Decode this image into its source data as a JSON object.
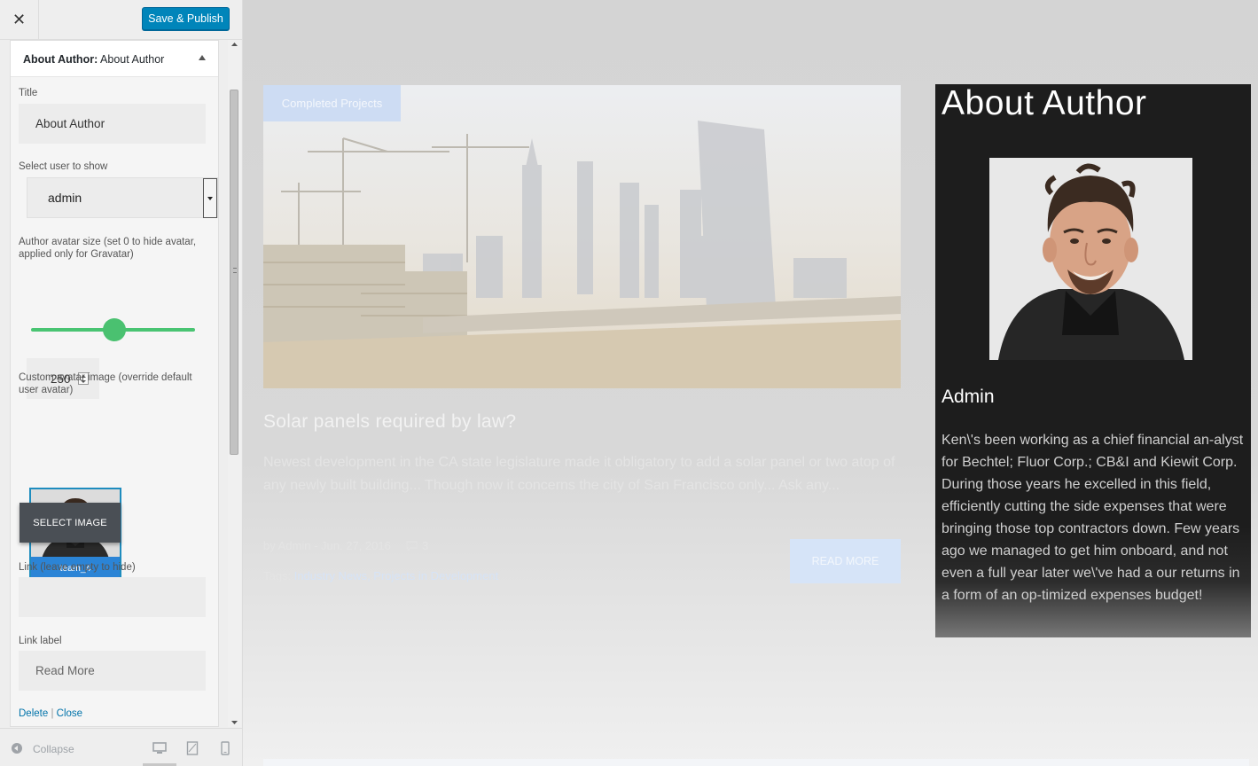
{
  "topbar": {
    "close_glyph": "✕",
    "publish_label": "Save & Publish"
  },
  "panel": {
    "title_prefix": "About Author:",
    "title_suffix": "About Author"
  },
  "form": {
    "title_label": "Title",
    "title_value": "About Author",
    "user_label": "Select user to show",
    "user_value": "admin",
    "avatar_size_label": "Author avatar size (set 0 to hide avatar, applied only for Gravatar)",
    "avatar_size_value": "250",
    "avatar_size_slider_fraction": 0.5,
    "custom_avatar_label": "Custom avatar image (override default user avatar)",
    "thumb_caption": "team_4",
    "select_image_label": "SELECT IMAGE",
    "link_label": "Link (leave empty to hide)",
    "link_value": "",
    "link_label_label": "Link label",
    "link_label_value": "Read More",
    "delete_label": "Delete",
    "separator": "|",
    "close_label": "Close"
  },
  "footer": {
    "collapse_label": "Collapse",
    "device_icons": [
      "desktop-icon",
      "tablet-icon",
      "mobile-icon"
    ]
  },
  "preview": {
    "badge": "Completed Projects",
    "post_title": "Solar panels required by law?",
    "excerpt": "Newest development in the CA state legislature made it obligatory to add a solar panel or two atop of any newly built building... Though now it concerns the city of San Francisco only... Ask any...",
    "meta": "by Admin  -  Jun. 27, 2016",
    "comment_count": "3",
    "tags_prefix": "Tags:",
    "tags": "Industry News, Projects in Development",
    "read_more": "READ MORE"
  },
  "widget": {
    "title": "About Author",
    "author_name": "Admin",
    "bio": "Ken\\'s been working as a chief financial an-alyst for Bechtel; Fluor Corp.; CB&I and Kiewit Corp. During those years he excelled in this field, efficiently cutting the side expenses that were bringing those top contractors down. Few years ago we managed to get him onboard, and not even a full year later we\\'ve had a our returns in a form of an op-timized expenses budget!"
  },
  "colors": {
    "publish_blue": "#0085ba",
    "slider_green": "#4ac170",
    "widget_bg": "#1d1d1d",
    "thumb_caption_bg": "#2b84d6"
  }
}
